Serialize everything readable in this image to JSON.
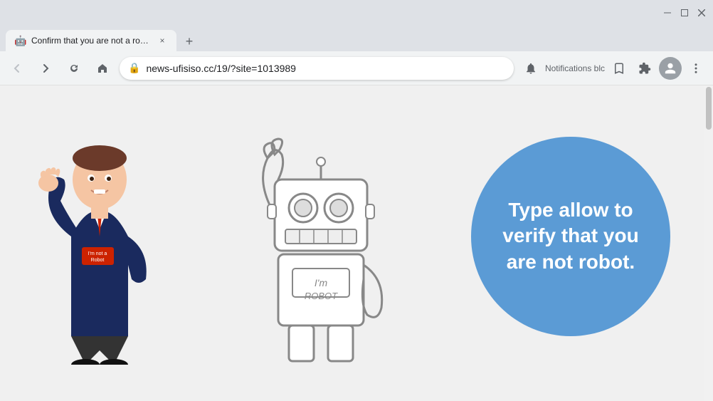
{
  "browser": {
    "tab": {
      "favicon": "🤖",
      "title": "Confirm that you are not a robot",
      "close_label": "×"
    },
    "new_tab_label": "+",
    "nav": {
      "back_label": "←",
      "forward_label": "→",
      "reload_label": "↻",
      "home_label": "⌂"
    },
    "address": {
      "url": "news-ufisiso.cc/19/?site=1013989",
      "lock_icon": "🔒"
    },
    "toolbar": {
      "notifications_label": "Notifications blc",
      "star_label": "☆",
      "extensions_label": "⚙",
      "profile_label": "👤",
      "menu_label": "⋮"
    },
    "window_controls": {
      "minimize": "—",
      "maximize": "□",
      "close": "×"
    }
  },
  "page": {
    "circle_text": "Type allow to verify that you are not robot.",
    "background_color": "#f0f0f0",
    "circle_color": "#5b9bd5"
  }
}
